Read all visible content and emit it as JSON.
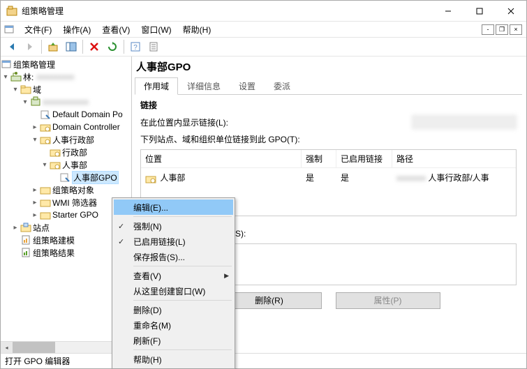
{
  "titlebar": {
    "title": "组策略管理"
  },
  "menu": {
    "file": "文件(F)",
    "action": "操作(A)",
    "view": "查看(V)",
    "window": "窗口(W)",
    "help": "帮助(H)"
  },
  "tree": {
    "root": "组策略管理",
    "forest": "林:",
    "domains": "域",
    "default_gpo": "Default Domain Po",
    "dc": "Domain Controller",
    "ou1": "人事行政部",
    "ou1a": "行政部",
    "ou1b": "人事部",
    "gpo_sel": "人事部GPO",
    "gpo_objs": "组策略对象",
    "wmi": "WMI 筛选器",
    "starter": "Starter GPO",
    "sites": "站点",
    "modeling": "组策略建模",
    "results": "组策略结果"
  },
  "right": {
    "title": "人事部GPO",
    "tabs": {
      "scope": "作用域",
      "details": "详细信息",
      "settings": "设置",
      "delegation": "委派"
    },
    "links_hdr": "链接",
    "show_links_label": "在此位置内显示链接(L):",
    "table_caption": "下列站点、域和组织单位链接到此 GPO(T):",
    "cols": {
      "location": "位置",
      "forced": "强制",
      "enabled": "已启用链接",
      "path": "路径"
    },
    "row1": {
      "location": "人事部",
      "forced": "是",
      "enabled": "是",
      "path": "人事行政部/人事"
    },
    "filter_label": "于下列组、用户和计算机(S):",
    "btn_remove": "删除(R)",
    "btn_props": "属性(P)"
  },
  "ctx": {
    "edit": "编辑(E)...",
    "force": "强制(N)",
    "enable_link": "已启用链接(L)",
    "save_report": "保存报告(S)...",
    "view": "查看(V)",
    "new_window": "从这里创建窗口(W)",
    "delete": "删除(D)",
    "rename": "重命名(M)",
    "refresh": "刷新(F)",
    "help": "帮助(H)"
  },
  "status": {
    "text": "打开 GPO 编辑器"
  }
}
